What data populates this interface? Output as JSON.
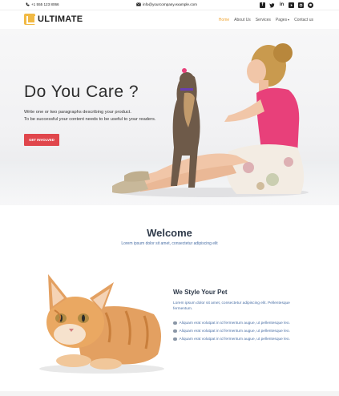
{
  "topbar": {
    "phone": "+1 555 123 8066",
    "email": "info@yourcompany.example.com",
    "social": [
      "facebook-icon",
      "twitter-icon",
      "linkedin-icon",
      "youtube-icon",
      "instagram-icon",
      "github-icon"
    ]
  },
  "brand": {
    "name": "ULTIMATE",
    "accent": "#f1b944"
  },
  "nav": {
    "items": [
      "Home",
      "About Us",
      "Services",
      "Pages",
      "Contact us"
    ],
    "active": "Home"
  },
  "hero": {
    "title": "Do You Care ?",
    "line1": "Write one or two paragraphs describing your product.",
    "line2": "To be successful your content needs to be useful to your readers.",
    "button": "GET INVOLVED",
    "button_color": "#e0464c"
  },
  "welcome": {
    "title": "Welcome",
    "subtitle": "Lorem ipsum dolor sit amet, consectetur adipiscing elit"
  },
  "feature": {
    "title": "We Style Your Pet",
    "text": "Lorem ipsum dolor sit amet, consectetur adipiscing elit. Pellentesque fermentum.",
    "list": [
      "Aliquam erat volutpat in id fermentum augue, ut pellentesque leo.",
      "Aliquam erat volutpat in id fermentum augue, ut pellentesque leo.",
      "Aliquam erat volutpat in id fermentum augue, ut pellentesque leo."
    ]
  }
}
